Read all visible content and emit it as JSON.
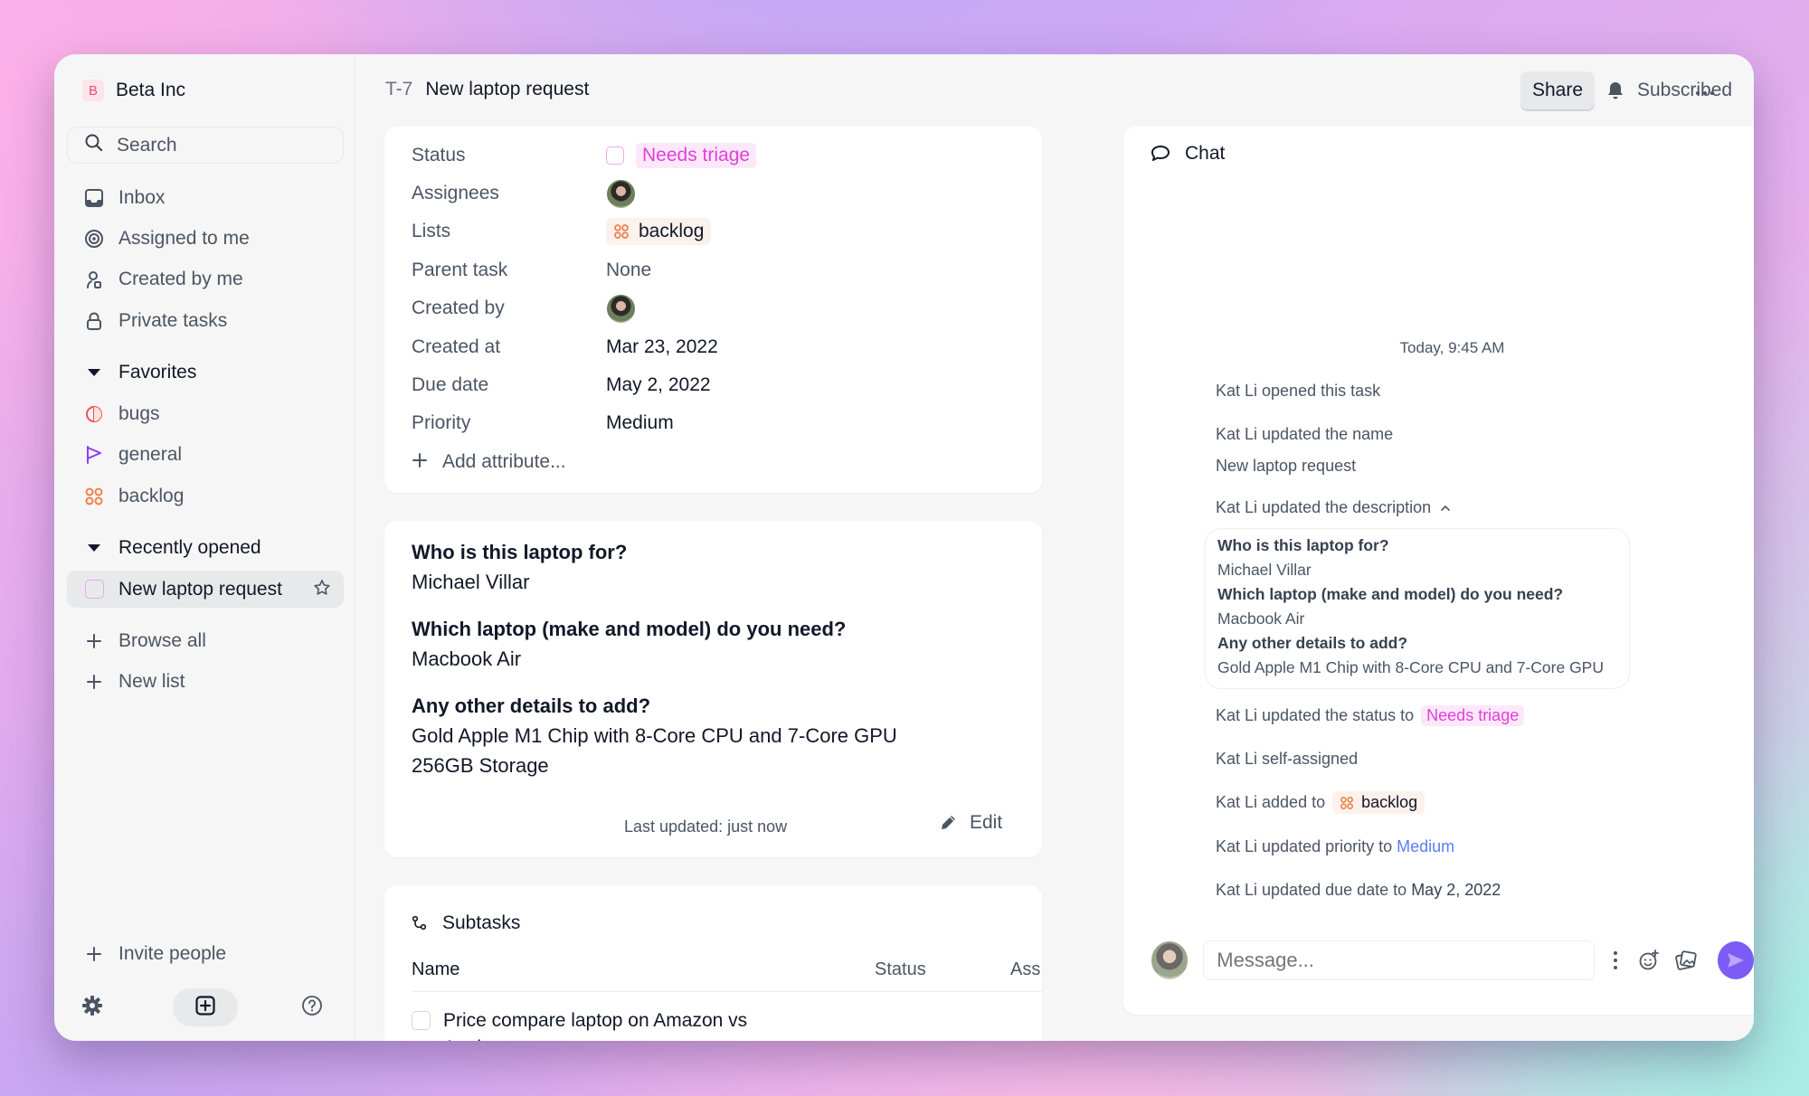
{
  "workspace": {
    "initial": "B",
    "name": "Beta Inc"
  },
  "sidebar": {
    "search_label": "Search",
    "nav": [
      {
        "icon": "inbox-icon",
        "label": "Inbox"
      },
      {
        "icon": "target-icon",
        "label": "Assigned to me"
      },
      {
        "icon": "user-created-icon",
        "label": "Created by me"
      },
      {
        "icon": "lock-icon",
        "label": "Private tasks"
      }
    ],
    "favorites": {
      "label": "Favorites",
      "items": [
        {
          "icon": "bug-circle-icon",
          "label": "bugs",
          "color": "#ef5350"
        },
        {
          "icon": "flag-icon",
          "label": "general",
          "color": "#8b3cf7"
        },
        {
          "icon": "four-dots-icon",
          "label": "backlog",
          "color": "#ef7f4a"
        }
      ]
    },
    "recent": {
      "label": "Recently opened",
      "items": [
        {
          "label": "New laptop request",
          "active": true
        }
      ]
    },
    "browse_all": "Browse all",
    "new_list": "New list",
    "invite": "Invite people"
  },
  "header": {
    "task_id": "T-7",
    "title": "New laptop request",
    "share": "Share",
    "subscribed": "Subscribed"
  },
  "properties": {
    "rows": [
      {
        "key": "Status",
        "value": "Needs triage"
      },
      {
        "key": "Assignees",
        "value": ""
      },
      {
        "key": "Lists",
        "value": "backlog"
      },
      {
        "key": "Parent task",
        "value": "None"
      },
      {
        "key": "Created by",
        "value": ""
      },
      {
        "key": "Created at",
        "value": "Mar 23, 2022"
      },
      {
        "key": "Due date",
        "value": "May 2, 2022"
      },
      {
        "key": "Priority",
        "value": "Medium"
      }
    ],
    "add_attribute": "Add attribute..."
  },
  "description": {
    "items": [
      {
        "q": "Who is this laptop for?",
        "a": [
          "Michael Villar"
        ]
      },
      {
        "q": "Which laptop (make and model) do you need?",
        "a": [
          "Macbook Air"
        ]
      },
      {
        "q": "Any other details to add?",
        "a": [
          "Gold Apple M1 Chip with 8-Core CPU and 7-Core GPU",
          "256GB Storage"
        ]
      }
    ],
    "last_updated": "Last updated: just now",
    "edit": "Edit"
  },
  "subtasks": {
    "title": "Subtasks",
    "columns": [
      "Name",
      "Status",
      "Ass"
    ],
    "rows": [
      {
        "name": "Price compare laptop on Amazon vs Apple"
      }
    ]
  },
  "chat": {
    "title": "Chat",
    "timestamp": "Today, 9:45 AM",
    "events": {
      "opened": "Kat Li opened this task",
      "name_updated": "Kat Li updated the name",
      "name_value": "New laptop request",
      "desc_prefix": "Kat Li updated the",
      "desc_word": "description",
      "desc_box": [
        {
          "t": "Who is this laptop for?",
          "q": true
        },
        {
          "t": "Michael Villar",
          "q": false
        },
        {
          "t": "Which laptop (make and model) do you need?",
          "q": true
        },
        {
          "t": "Macbook Air",
          "q": false
        },
        {
          "t": "Any other details to add?",
          "q": true
        },
        {
          "t": "Gold Apple M1 Chip with 8-Core CPU and 7-Core GPU",
          "q": false
        }
      ],
      "status_prefix": "Kat Li updated the status to",
      "status_value": "Needs triage",
      "self_assigned": "Kat Li self-assigned",
      "added_prefix": "Kat Li added to",
      "added_value": "backlog",
      "priority_prefix": "Kat Li updated priority to",
      "priority_value": "Medium",
      "due_prefix": "Kat Li updated due date to",
      "due_value": "May 2, 2022"
    },
    "message_placeholder": "Message..."
  },
  "colors": {
    "accent": "#7b5cf5",
    "status_pink": "#e040d8",
    "priority_blue": "#5b7cf6",
    "backlog_orange": "#ef7f4a"
  }
}
